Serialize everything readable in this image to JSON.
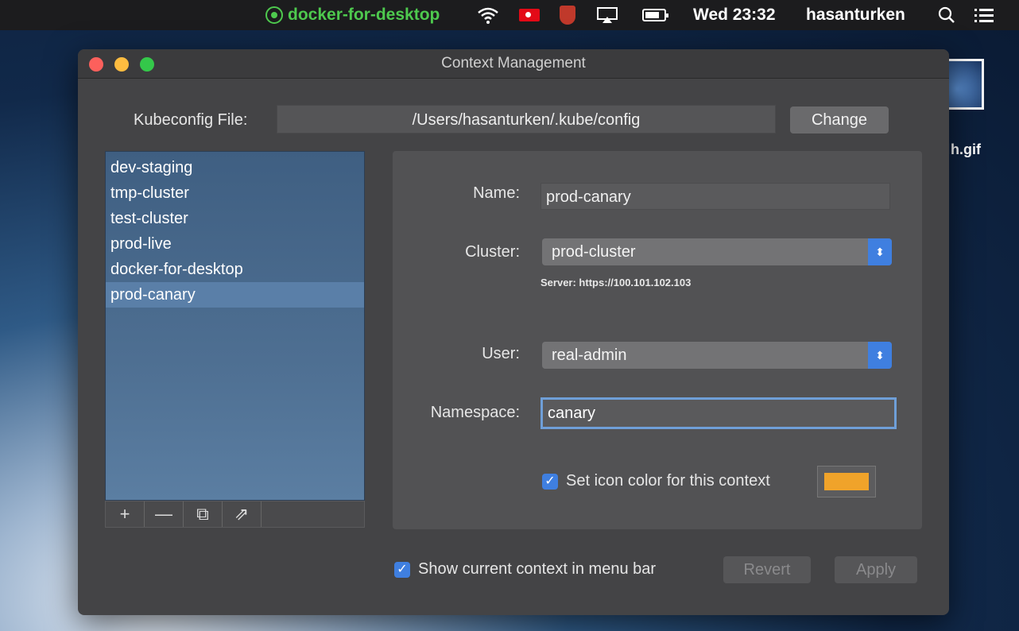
{
  "menubar": {
    "current_context": "docker-for-desktop",
    "clock": "Wed 23:32",
    "user": "hasanturken",
    "icons": [
      "kubernetes-icon",
      "wifi-icon",
      "turkish-flag-icon",
      "mcafee-shield-icon",
      "airplay-icon",
      "battery-icon",
      "spotlight-search-icon",
      "notification-list-icon"
    ]
  },
  "desktop": {
    "file_label": "h.gif"
  },
  "window": {
    "title": "Context Management",
    "kubeconfig_label": "Kubeconfig File:",
    "kubeconfig_path": "/Users/hasanturken/.kube/config",
    "change_label": "Change",
    "contexts": [
      {
        "name": "dev-staging",
        "selected": false
      },
      {
        "name": "tmp-cluster",
        "selected": false
      },
      {
        "name": "test-cluster",
        "selected": false
      },
      {
        "name": "prod-live",
        "selected": false
      },
      {
        "name": "docker-for-desktop",
        "selected": false
      },
      {
        "name": "prod-canary",
        "selected": true
      }
    ],
    "list_toolbar": {
      "add": "+",
      "remove": "—",
      "duplicate": "⧉",
      "export": "⇗"
    },
    "detail": {
      "name_label": "Name:",
      "name_value": "prod-canary",
      "cluster_label": "Cluster:",
      "cluster_value": "prod-cluster",
      "server_text": "Server: https://100.101.102.103",
      "user_label": "User:",
      "user_value": "real-admin",
      "namespace_label": "Namespace:",
      "namespace_value": "canary",
      "icon_color_checked": true,
      "icon_color_label": "Set icon color for this context",
      "icon_color": "#f0a32a"
    },
    "show_in_menubar_checked": true,
    "show_in_menubar_label": "Show current context in menu bar",
    "revert_label": "Revert",
    "apply_label": "Apply"
  }
}
